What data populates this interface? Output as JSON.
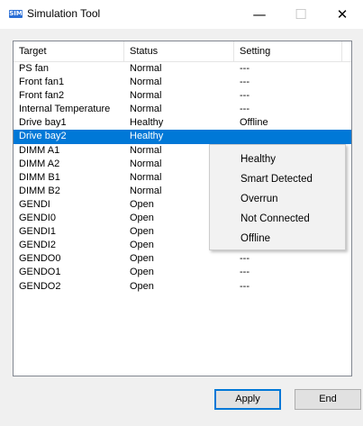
{
  "window": {
    "icon_label": "SIM",
    "title": "Simulation Tool",
    "controls": {
      "minimize": "—",
      "maximize": "☐",
      "close": "✕"
    }
  },
  "list": {
    "columns": [
      "Target",
      "Status",
      "Setting"
    ],
    "rows": [
      {
        "target": "PS fan",
        "status": "Normal",
        "setting": "---"
      },
      {
        "target": "Front fan1",
        "status": "Normal",
        "setting": "---"
      },
      {
        "target": "Front fan2",
        "status": "Normal",
        "setting": "---"
      },
      {
        "target": "Internal Temperature",
        "status": "Normal",
        "setting": "---"
      },
      {
        "target": "Drive bay1",
        "status": "Healthy",
        "setting": "Offline"
      },
      {
        "target": "Drive bay2",
        "status": "Healthy",
        "setting": ""
      },
      {
        "target": "DIMM A1",
        "status": "Normal",
        "setting": ""
      },
      {
        "target": "DIMM A2",
        "status": "Normal",
        "setting": ""
      },
      {
        "target": "DIMM B1",
        "status": "Normal",
        "setting": ""
      },
      {
        "target": "DIMM B2",
        "status": "Normal",
        "setting": ""
      },
      {
        "target": "GENDI",
        "status": "Open",
        "setting": ""
      },
      {
        "target": "GENDI0",
        "status": "Open",
        "setting": ""
      },
      {
        "target": "GENDI1",
        "status": "Open",
        "setting": "---"
      },
      {
        "target": "GENDI2",
        "status": "Open",
        "setting": "---"
      },
      {
        "target": "GENDO0",
        "status": "Open",
        "setting": "---"
      },
      {
        "target": "GENDO1",
        "status": "Open",
        "setting": "---"
      },
      {
        "target": "GENDO2",
        "status": "Open",
        "setting": "---"
      }
    ],
    "selected_row": "Drive bay2"
  },
  "context_menu": {
    "items": [
      "Healthy",
      "Smart Detected",
      "Overrun",
      "Not Connected",
      "Offline"
    ]
  },
  "buttons": {
    "apply": "Apply",
    "end": "End"
  },
  "colors": {
    "selection": "#0078d7",
    "default_button_border": "#0078d7"
  }
}
